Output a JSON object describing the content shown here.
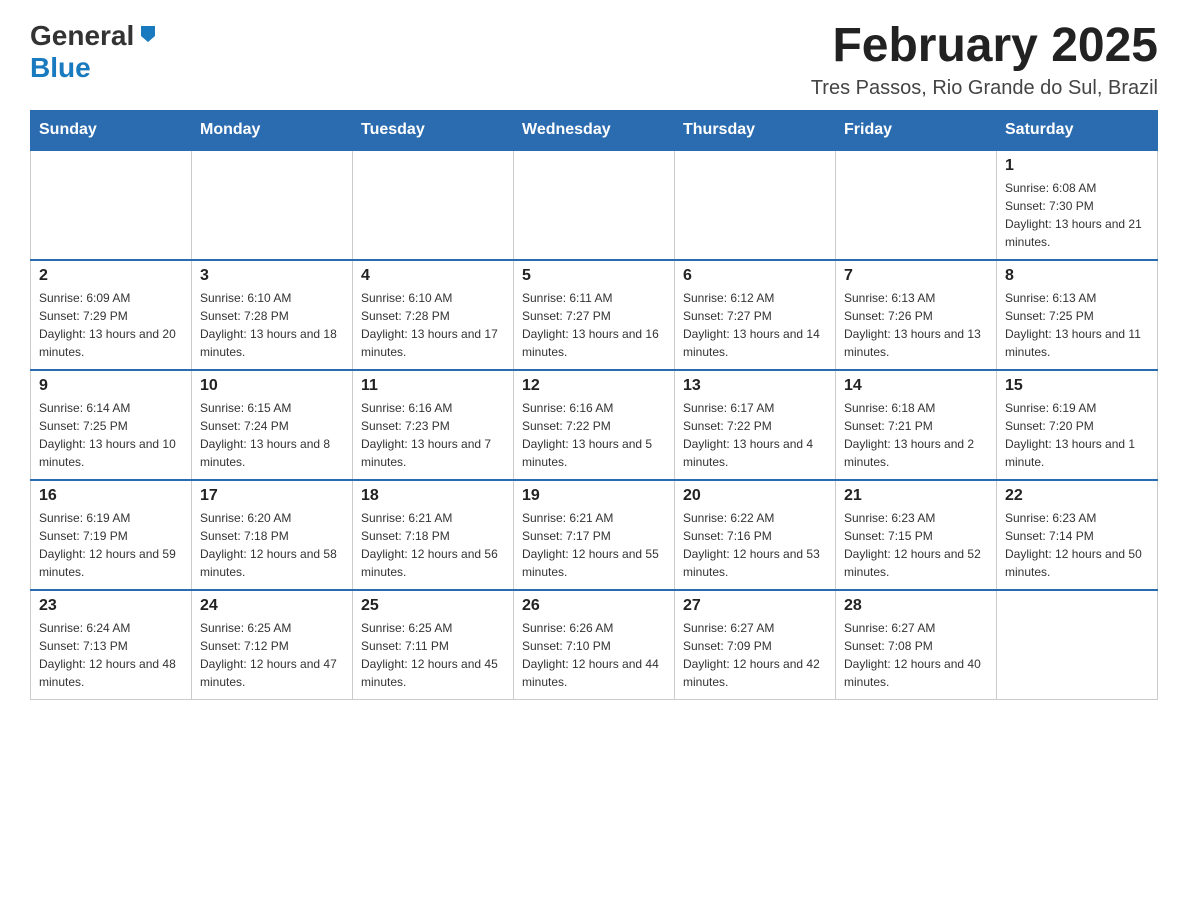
{
  "logo": {
    "general": "General",
    "blue": "Blue"
  },
  "title": {
    "month_year": "February 2025",
    "location": "Tres Passos, Rio Grande do Sul, Brazil"
  },
  "weekdays": [
    "Sunday",
    "Monday",
    "Tuesday",
    "Wednesday",
    "Thursday",
    "Friday",
    "Saturday"
  ],
  "weeks": [
    [
      {
        "day": "",
        "info": ""
      },
      {
        "day": "",
        "info": ""
      },
      {
        "day": "",
        "info": ""
      },
      {
        "day": "",
        "info": ""
      },
      {
        "day": "",
        "info": ""
      },
      {
        "day": "",
        "info": ""
      },
      {
        "day": "1",
        "info": "Sunrise: 6:08 AM\nSunset: 7:30 PM\nDaylight: 13 hours and 21 minutes."
      }
    ],
    [
      {
        "day": "2",
        "info": "Sunrise: 6:09 AM\nSunset: 7:29 PM\nDaylight: 13 hours and 20 minutes."
      },
      {
        "day": "3",
        "info": "Sunrise: 6:10 AM\nSunset: 7:28 PM\nDaylight: 13 hours and 18 minutes."
      },
      {
        "day": "4",
        "info": "Sunrise: 6:10 AM\nSunset: 7:28 PM\nDaylight: 13 hours and 17 minutes."
      },
      {
        "day": "5",
        "info": "Sunrise: 6:11 AM\nSunset: 7:27 PM\nDaylight: 13 hours and 16 minutes."
      },
      {
        "day": "6",
        "info": "Sunrise: 6:12 AM\nSunset: 7:27 PM\nDaylight: 13 hours and 14 minutes."
      },
      {
        "day": "7",
        "info": "Sunrise: 6:13 AM\nSunset: 7:26 PM\nDaylight: 13 hours and 13 minutes."
      },
      {
        "day": "8",
        "info": "Sunrise: 6:13 AM\nSunset: 7:25 PM\nDaylight: 13 hours and 11 minutes."
      }
    ],
    [
      {
        "day": "9",
        "info": "Sunrise: 6:14 AM\nSunset: 7:25 PM\nDaylight: 13 hours and 10 minutes."
      },
      {
        "day": "10",
        "info": "Sunrise: 6:15 AM\nSunset: 7:24 PM\nDaylight: 13 hours and 8 minutes."
      },
      {
        "day": "11",
        "info": "Sunrise: 6:16 AM\nSunset: 7:23 PM\nDaylight: 13 hours and 7 minutes."
      },
      {
        "day": "12",
        "info": "Sunrise: 6:16 AM\nSunset: 7:22 PM\nDaylight: 13 hours and 5 minutes."
      },
      {
        "day": "13",
        "info": "Sunrise: 6:17 AM\nSunset: 7:22 PM\nDaylight: 13 hours and 4 minutes."
      },
      {
        "day": "14",
        "info": "Sunrise: 6:18 AM\nSunset: 7:21 PM\nDaylight: 13 hours and 2 minutes."
      },
      {
        "day": "15",
        "info": "Sunrise: 6:19 AM\nSunset: 7:20 PM\nDaylight: 13 hours and 1 minute."
      }
    ],
    [
      {
        "day": "16",
        "info": "Sunrise: 6:19 AM\nSunset: 7:19 PM\nDaylight: 12 hours and 59 minutes."
      },
      {
        "day": "17",
        "info": "Sunrise: 6:20 AM\nSunset: 7:18 PM\nDaylight: 12 hours and 58 minutes."
      },
      {
        "day": "18",
        "info": "Sunrise: 6:21 AM\nSunset: 7:18 PM\nDaylight: 12 hours and 56 minutes."
      },
      {
        "day": "19",
        "info": "Sunrise: 6:21 AM\nSunset: 7:17 PM\nDaylight: 12 hours and 55 minutes."
      },
      {
        "day": "20",
        "info": "Sunrise: 6:22 AM\nSunset: 7:16 PM\nDaylight: 12 hours and 53 minutes."
      },
      {
        "day": "21",
        "info": "Sunrise: 6:23 AM\nSunset: 7:15 PM\nDaylight: 12 hours and 52 minutes."
      },
      {
        "day": "22",
        "info": "Sunrise: 6:23 AM\nSunset: 7:14 PM\nDaylight: 12 hours and 50 minutes."
      }
    ],
    [
      {
        "day": "23",
        "info": "Sunrise: 6:24 AM\nSunset: 7:13 PM\nDaylight: 12 hours and 48 minutes."
      },
      {
        "day": "24",
        "info": "Sunrise: 6:25 AM\nSunset: 7:12 PM\nDaylight: 12 hours and 47 minutes."
      },
      {
        "day": "25",
        "info": "Sunrise: 6:25 AM\nSunset: 7:11 PM\nDaylight: 12 hours and 45 minutes."
      },
      {
        "day": "26",
        "info": "Sunrise: 6:26 AM\nSunset: 7:10 PM\nDaylight: 12 hours and 44 minutes."
      },
      {
        "day": "27",
        "info": "Sunrise: 6:27 AM\nSunset: 7:09 PM\nDaylight: 12 hours and 42 minutes."
      },
      {
        "day": "28",
        "info": "Sunrise: 6:27 AM\nSunset: 7:08 PM\nDaylight: 12 hours and 40 minutes."
      },
      {
        "day": "",
        "info": ""
      }
    ]
  ]
}
